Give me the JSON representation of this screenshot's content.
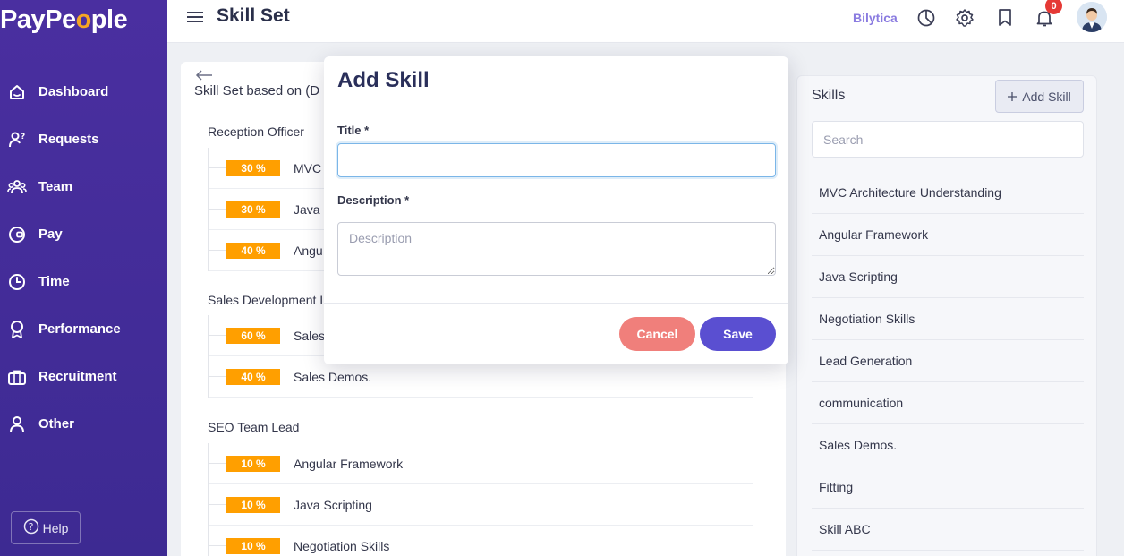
{
  "app": {
    "logo_text_a": "PayPe",
    "logo_text_b": "o",
    "logo_text_c": "ple"
  },
  "sidebar": {
    "items": [
      {
        "label": "Dashboard",
        "icon": "home-icon"
      },
      {
        "label": "Requests",
        "icon": "user-question-icon"
      },
      {
        "label": "Team",
        "icon": "team-icon"
      },
      {
        "label": "Pay",
        "icon": "wallet-icon"
      },
      {
        "label": "Time",
        "icon": "clock-icon"
      },
      {
        "label": "Performance",
        "icon": "award-icon"
      },
      {
        "label": "Recruitment",
        "icon": "briefcase-icon"
      },
      {
        "label": "Other",
        "icon": "user-icon"
      }
    ],
    "help_label": "Help"
  },
  "header": {
    "title": "Skill Set",
    "company": "Bilytica",
    "notification_count": "0"
  },
  "left_panel": {
    "title": "Skill Set based on (D",
    "groups": [
      {
        "name": "Reception Officer",
        "skills": [
          {
            "pct": "30 %",
            "name": "MVC"
          },
          {
            "pct": "30 %",
            "name": "Java"
          },
          {
            "pct": "40 %",
            "name": "Angu"
          }
        ]
      },
      {
        "name": "Sales Development I",
        "skills": [
          {
            "pct": "60 %",
            "name": "Sales"
          },
          {
            "pct": "40 %",
            "name": "Sales Demos."
          }
        ]
      },
      {
        "name": "SEO Team Lead",
        "skills": [
          {
            "pct": "10 %",
            "name": "Angular Framework"
          },
          {
            "pct": "10 %",
            "name": "Java Scripting"
          },
          {
            "pct": "10 %",
            "name": "Negotiation Skills"
          }
        ]
      }
    ]
  },
  "right_panel": {
    "title": "Skills",
    "add_button": "Add Skill",
    "search_placeholder": "Search",
    "skills": [
      "MVC Architecture Understanding",
      "Angular Framework",
      "Java Scripting",
      "Negotiation Skills",
      "Lead Generation",
      "communication",
      "Sales Demos.",
      "Fitting",
      "Skill ABC"
    ]
  },
  "modal": {
    "title": "Add Skill",
    "title_label": "Title *",
    "title_value": "",
    "description_label": "Description *",
    "description_placeholder": "Description",
    "cancel_label": "Cancel",
    "save_label": "Save"
  },
  "colors": {
    "sidebar": "#4a2fa0",
    "percent_badge": "#ff9f00",
    "save": "#5a4fd1",
    "cancel": "#f07f7b",
    "company": "#8a7be0"
  }
}
